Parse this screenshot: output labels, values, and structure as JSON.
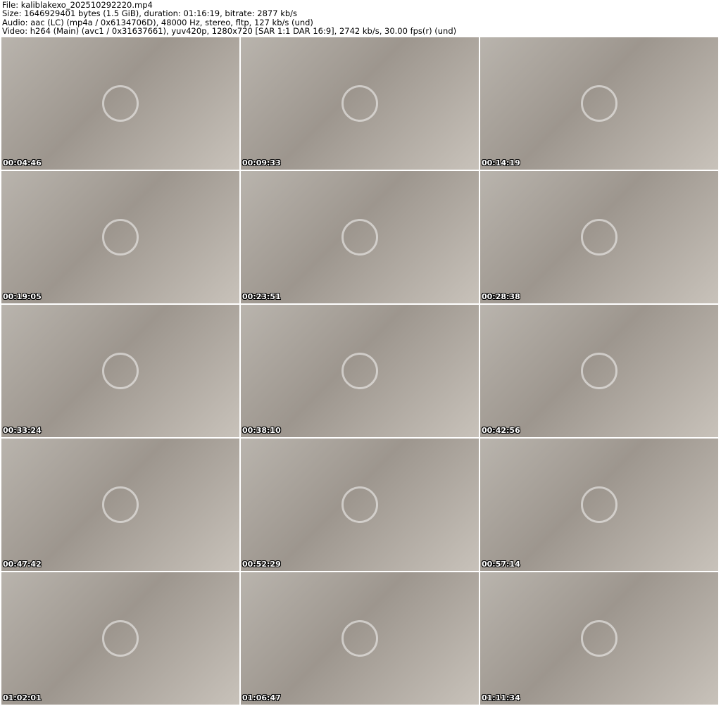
{
  "header": {
    "file": "File: kaliblakexo_202510292220.mp4",
    "size": "Size: 1646929401 bytes (1.5 GiB), duration: 01:16:19, bitrate: 2877 kb/s",
    "audio": "Audio: aac (LC) (mp4a / 0x6134706D), 48000 Hz, stereo, fltp, 127 kb/s (und)",
    "video": "Video: h264 (Main) (avc1 / 0x31637661), yuv420p, 1280x720 [SAR 1:1 DAR 16:9], 2742 kb/s, 30.00 fps(r) (und)"
  },
  "thumbnails": [
    {
      "timestamp": "00:04:46"
    },
    {
      "timestamp": "00:09:33"
    },
    {
      "timestamp": "00:14:19"
    },
    {
      "timestamp": "00:19:05"
    },
    {
      "timestamp": "00:23:51"
    },
    {
      "timestamp": "00:28:38"
    },
    {
      "timestamp": "00:33:24"
    },
    {
      "timestamp": "00:38:10"
    },
    {
      "timestamp": "00:42:56"
    },
    {
      "timestamp": "00:47:42"
    },
    {
      "timestamp": "00:52:29"
    },
    {
      "timestamp": "00:57:14"
    },
    {
      "timestamp": "01:02:01"
    },
    {
      "timestamp": "01:06:47"
    },
    {
      "timestamp": "01:11:34"
    }
  ]
}
